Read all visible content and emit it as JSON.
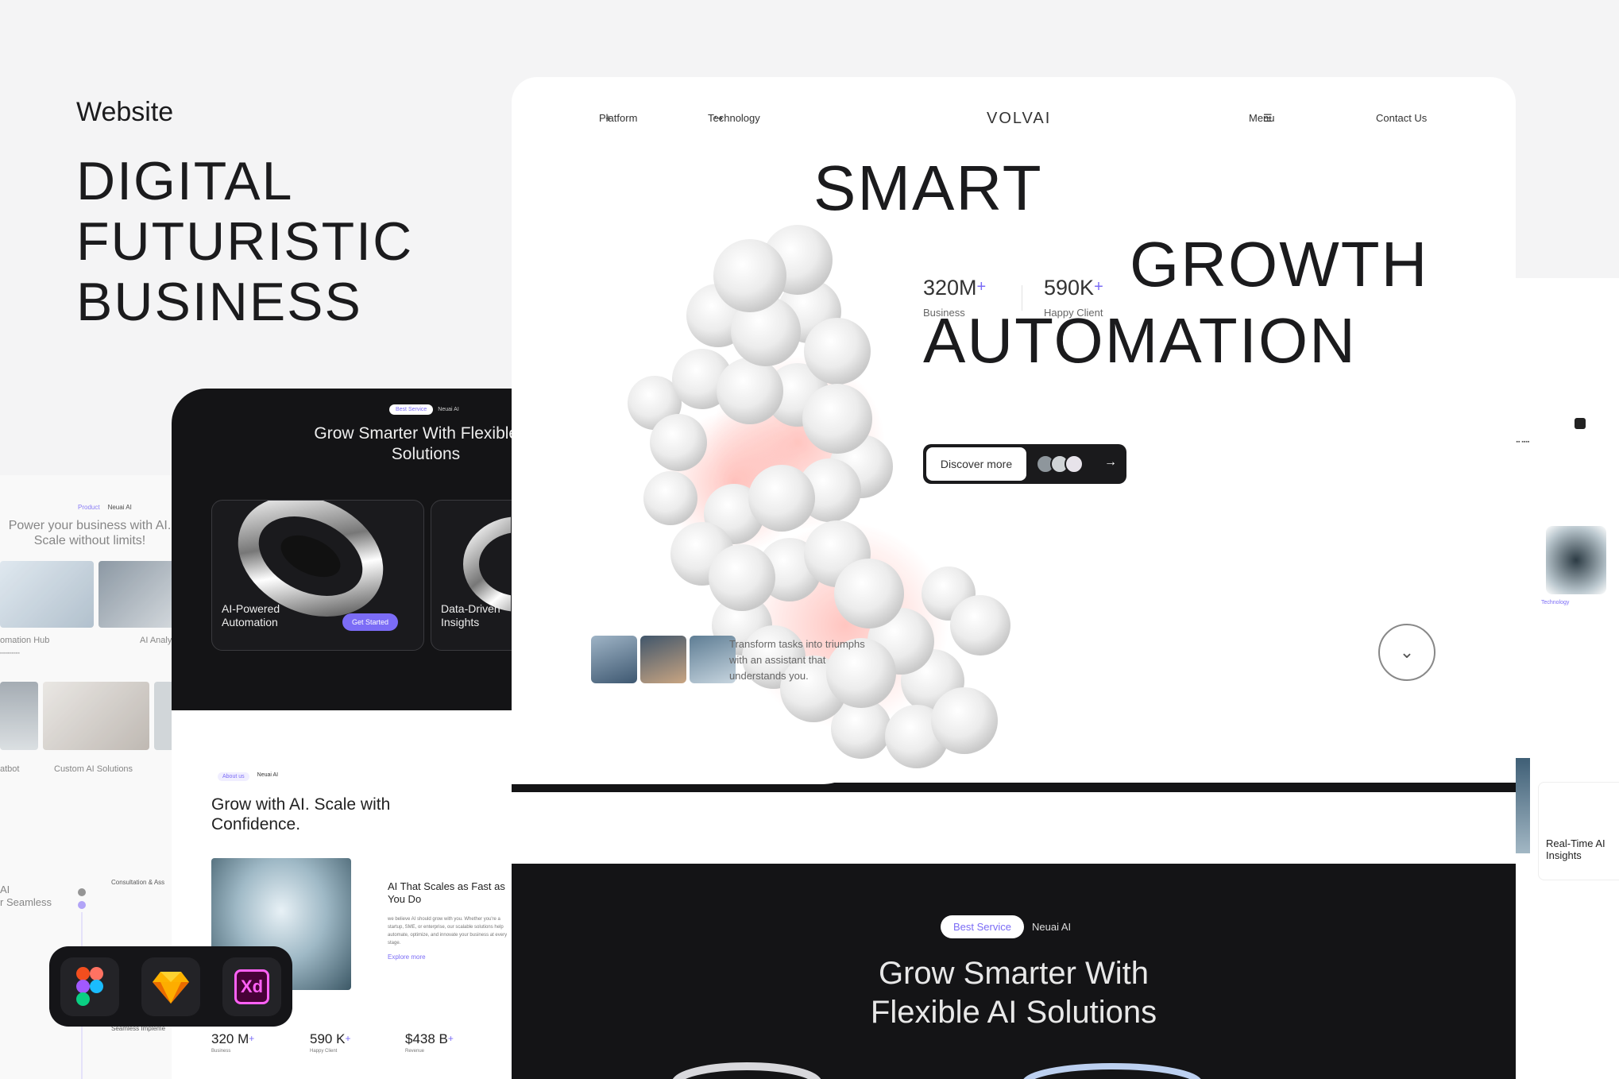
{
  "presentation": {
    "eyebrow": "Website",
    "title_lines": [
      "DIGITAL",
      "FUTURISTIC",
      "BUSINESS"
    ]
  },
  "main": {
    "nav": {
      "platform": "Platform",
      "technology": "Technology",
      "logo": "VOLVAI",
      "menu": "Menu",
      "contact": "Contact Us"
    },
    "headline": [
      "SMART",
      "GROWTH",
      "AUTOMATION"
    ],
    "stats": [
      {
        "value": "320M",
        "suffix": "+",
        "label": "Business"
      },
      {
        "value": "590K",
        "suffix": "+",
        "label": "Happy Client"
      }
    ],
    "cta_label": "Discover more",
    "testimonial": "Transform tasks into triumphs with an assistant that understands you.",
    "section_pills": [
      "Best Service",
      "Neuai AI"
    ],
    "section_title": "Grow Smarter With Flexible AI Solutions"
  },
  "dark_card": {
    "pills": [
      "Best Service",
      "Neuai AI"
    ],
    "title": "Grow Smarter With Flexible AI Solutions",
    "features": [
      {
        "label": "AI-Powered Automation",
        "button": "Get Started"
      },
      {
        "label": "Data-Driven Insights"
      }
    ]
  },
  "about": {
    "pills": [
      "About us",
      "Neuai AI"
    ],
    "title": "Grow with AI. Scale with Confidence.",
    "subtitle": "AI That Scales as Fast as You Do",
    "body": "we believe AI should grow with you. Whether you're a startup, SME, or enterprise, our scalable solutions help automate, optimize, and innovate your business at every stage.",
    "link": "Explore more",
    "stats": [
      {
        "value": "320 M",
        "suffix": "+",
        "label": "Business"
      },
      {
        "value": "590 K",
        "suffix": "+",
        "label": "Happy Client"
      },
      {
        "value": "$438 B",
        "suffix": "+",
        "label": "Revenue"
      }
    ]
  },
  "ghost_left": {
    "crumb": [
      "Product",
      "Neuai AI"
    ],
    "intro": "Power your business with AI. Scale without limits!",
    "items": [
      "omation Hub",
      "AI Analy",
      "atbot",
      "Custom AI Solutions"
    ],
    "side_text": [
      "AI",
      "r Seamless"
    ],
    "consult": "Consultation & Ass",
    "seamless": "Seamless Impleme"
  },
  "ghost_right": {
    "label": "Real-Time AI Insights",
    "tech": "Technology"
  },
  "tools": [
    "figma-icon",
    "sketch-icon",
    "xd-icon"
  ],
  "colors": {
    "accent": "#7b6cf6",
    "dark": "#141416",
    "background": "#f4f4f5"
  }
}
